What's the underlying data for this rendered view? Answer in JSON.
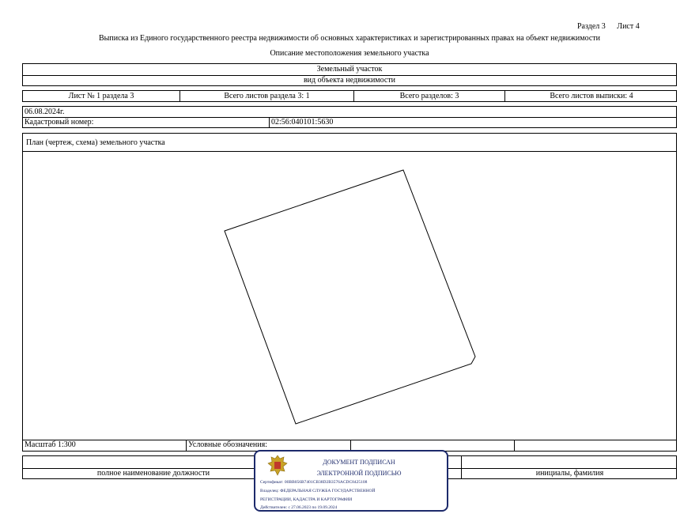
{
  "header": {
    "section": "Раздел 3",
    "sheet": "Лист 4",
    "title": "Выписка из Единого государственного реестра недвижимости об основных характеристиках и зарегистрированных правах на объект недвижимости",
    "subtitle": "Описание местоположения земельного участка"
  },
  "object": {
    "type_value": "Земельный участок",
    "type_label": "вид объекта недвижимости"
  },
  "sheets_row": {
    "sheet_of_section": "Лист № 1 раздела 3",
    "total_sheets_section": "Всего листов раздела 3: 1",
    "total_sections": "Всего разделов: 3",
    "total_sheets_extract": "Всего листов выписки: 4"
  },
  "date": "06.08.2024г.",
  "cadastral": {
    "label": "Кадастровый номер:",
    "value": "02:56:040101:5630"
  },
  "plan": {
    "title": "План (чертеж, схема) земельного участка",
    "scale": "Масштаб 1:300",
    "legend_label": "Условные обозначения:"
  },
  "signature_row": {
    "position_label": "полное наименование должности",
    "name_label": "инициалы, фамилия"
  },
  "stamp": {
    "line1": "ДОКУМЕНТ ПОДПИСАН",
    "line2": "ЭЛЕКТРОННОЙ ПОДПИСЬЮ",
    "certificate": "Сертификат: 00BB056B7401CB38D2B3576ACDC8425108",
    "owner1": "Владелец: ФЕДЕРАЛЬНАЯ СЛУЖБА ГОСУДАРСТВЕННОЙ",
    "owner2": "РЕГИСТРАЦИИ, КАДАСТРА И КАРТОГРАФИИ",
    "valid": "Действителен: с 27.06.2023 по 19.09.2024",
    "emblem_color": "#c0392b",
    "border_color": "#1d2a6b"
  }
}
